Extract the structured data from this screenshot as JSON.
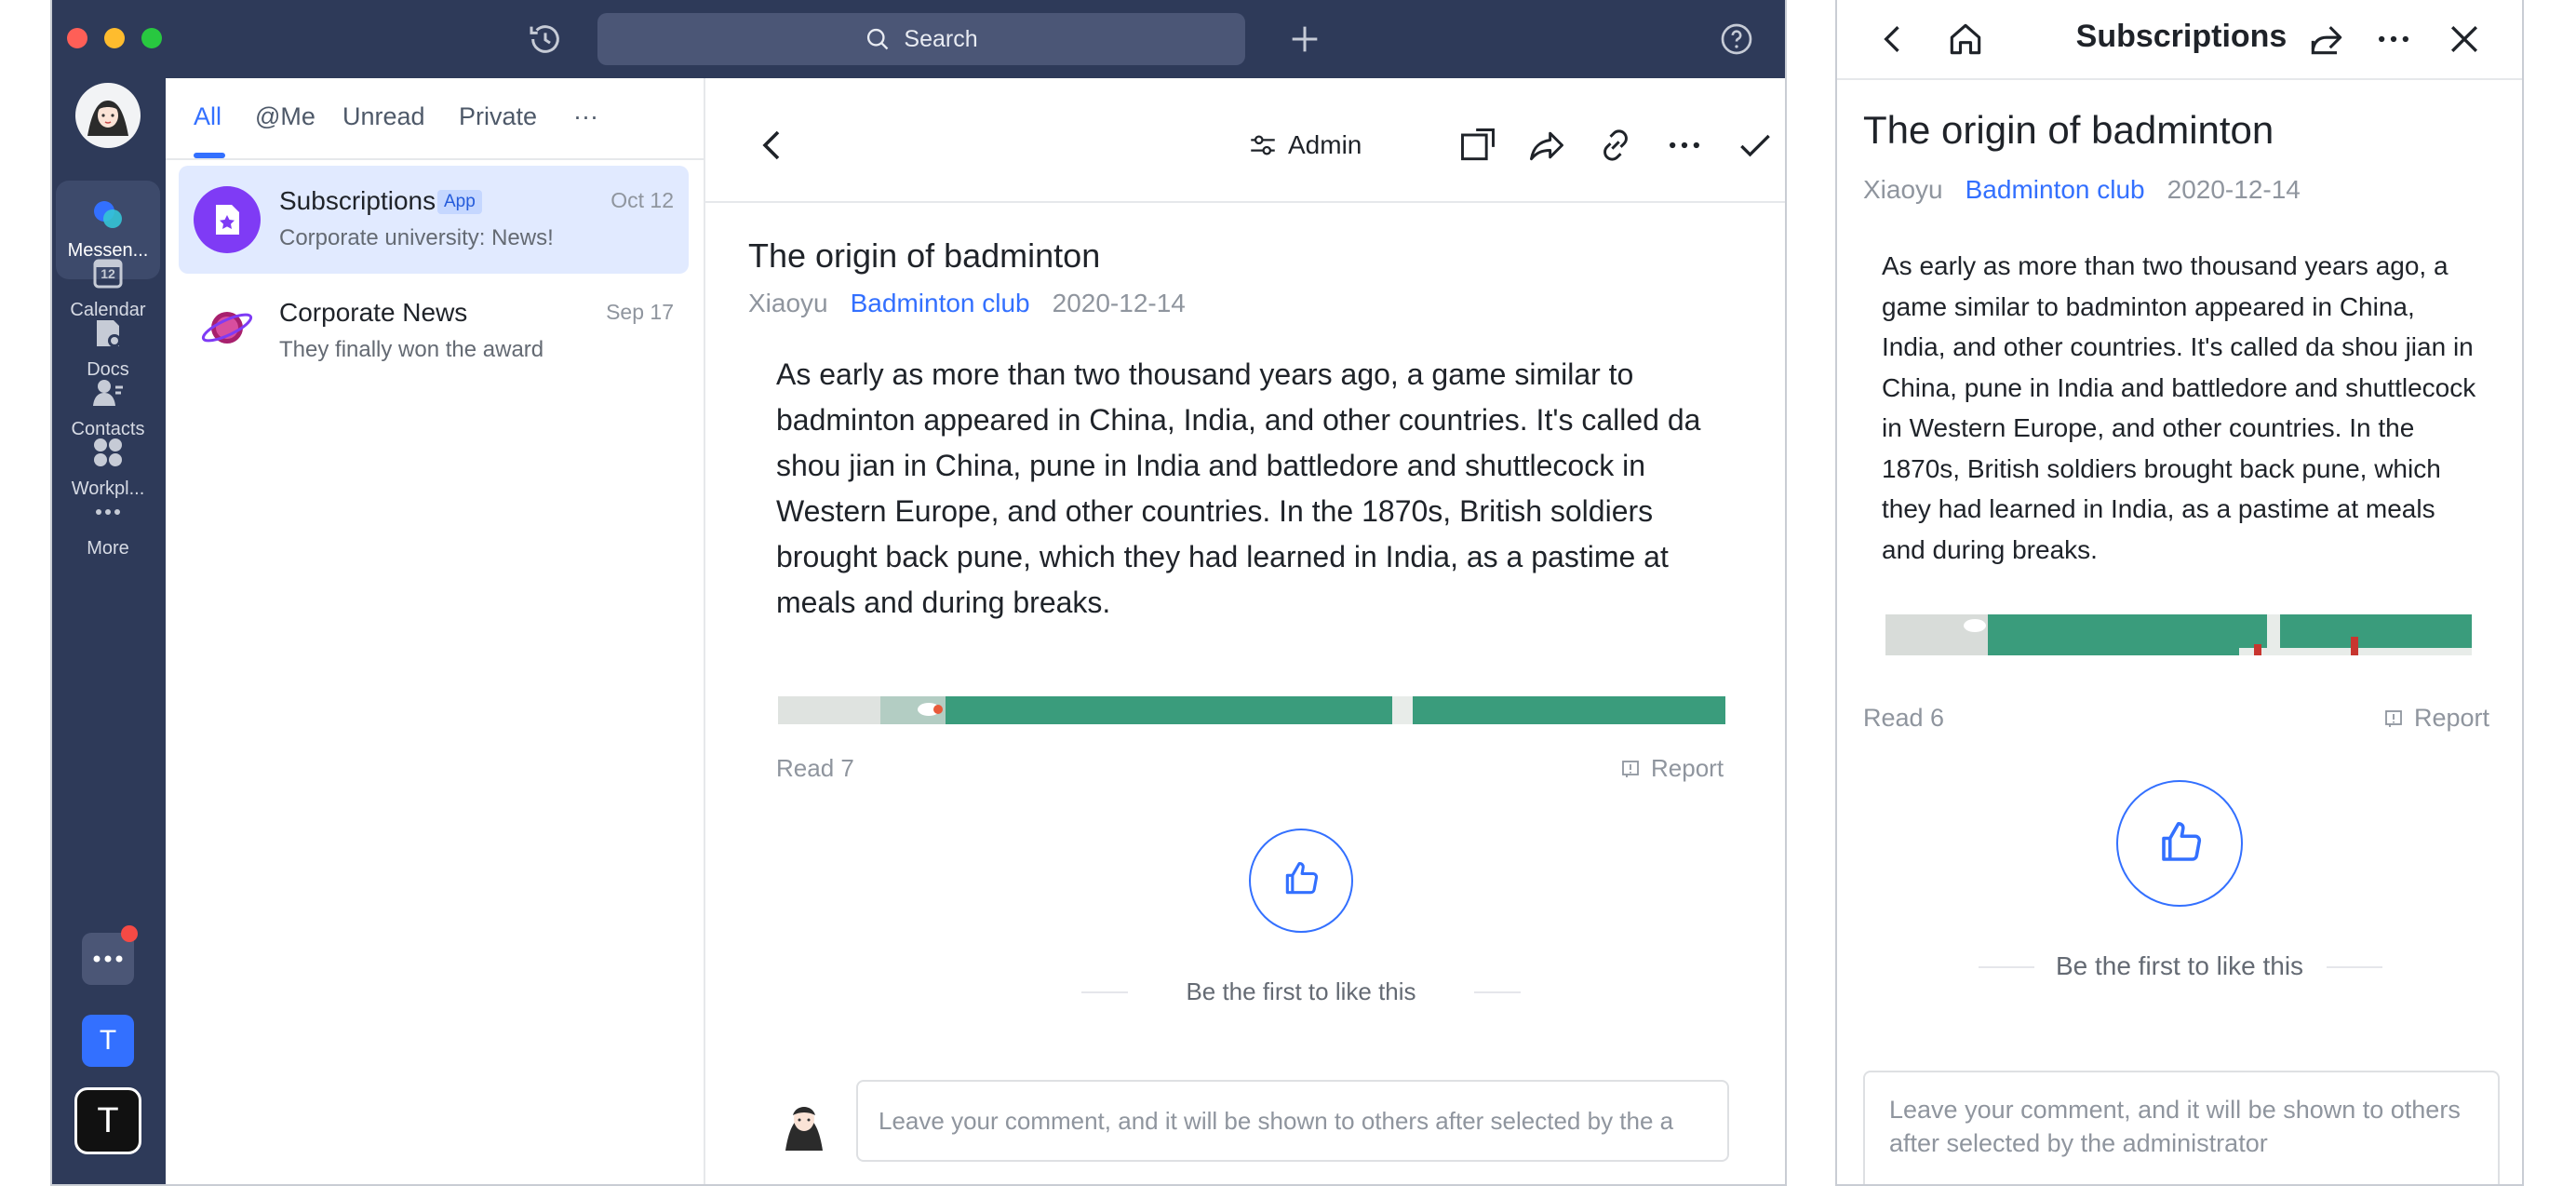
{
  "desktop": {
    "search_label": "Search",
    "nav": [
      {
        "label": "Messen...",
        "icon": "messenger-icon",
        "active": true
      },
      {
        "label": "Calendar",
        "icon": "calendar-icon",
        "active": false
      },
      {
        "label": "Docs",
        "icon": "docs-icon",
        "active": false
      },
      {
        "label": "Contacts",
        "icon": "contacts-icon",
        "active": false
      },
      {
        "label": "Workpl...",
        "icon": "workplace-icon",
        "active": false
      },
      {
        "label": "More",
        "icon": "more-icon",
        "active": false
      }
    ],
    "calendar_day": "12",
    "bottom_apps": {
      "t_label": "T",
      "t2_label": "T"
    },
    "tabs": [
      "All",
      "@Me",
      "Unread",
      "Private",
      "···"
    ],
    "conversations": [
      {
        "title": "Subscriptions",
        "badge": "App",
        "subtitle": "Corporate university: News!",
        "date": "Oct 12"
      },
      {
        "title": "Corporate News",
        "subtitle": "They finally won the award",
        "date": "Sep 17"
      }
    ],
    "toolbar": {
      "admin_label": "Admin"
    },
    "article": {
      "title": "The origin of badminton",
      "author": "Xiaoyu",
      "group": "Badminton club",
      "date": "2020-12-14",
      "body": "As early as more than two thousand years ago, a game similar to badminton appeared in China, India, and other countries. It's called da shou jian in China, pune in India and battledore and shuttlecock in Western Europe, and other countries. In the 1870s, British soldiers brought back pune, which they had learned in India, as a pastime at meals and during breaks.",
      "read": "Read 7",
      "report": "Report",
      "like_text": "Be the first to like this",
      "comment_placeholder": "Leave your comment, and it will be shown to others after selected by the a"
    }
  },
  "mobile": {
    "header_title": "Subscriptions",
    "article": {
      "title": "The origin of badminton",
      "author": "Xiaoyu",
      "group": "Badminton club",
      "date": "2020-12-14",
      "body": "As early as more than two thousand years ago, a game similar to badminton appeared in China, India, and other countries. It's called da shou jian in China, pune in India and battledore and shuttlecock in Western Europe, and other countries. In the 1870s, British soldiers brought back pune, which they had learned in India, as a pastime at meals and during breaks.",
      "read": "Read 6",
      "report": "Report",
      "like_text": "Be the first to like this",
      "comment_placeholder": "Leave your comment, and it will be shown to others after selected by the administrator"
    }
  },
  "colors": {
    "sidebar": "#2e3a59",
    "accent": "#3370ff",
    "selected_row": "#e1eaff",
    "subscriptions_avatar": "#7f3bf5",
    "notification_dot": "#f54a45"
  }
}
